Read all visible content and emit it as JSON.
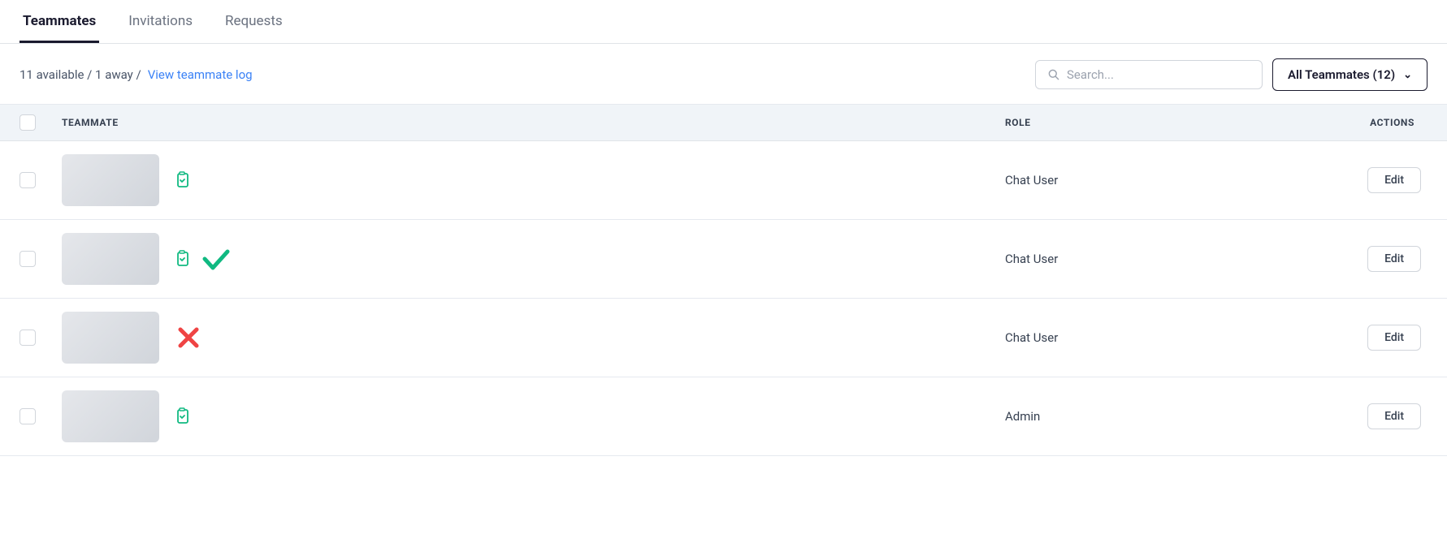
{
  "tabs": [
    {
      "id": "teammates",
      "label": "Teammates",
      "active": true
    },
    {
      "id": "invitations",
      "label": "Invitations",
      "active": false
    },
    {
      "id": "requests",
      "label": "Requests",
      "active": false
    }
  ],
  "toolbar": {
    "stats": "11 available / 1 away /",
    "view_log_label": "View teammate log",
    "search_placeholder": "Search...",
    "filter_label": "All Teammates (12)"
  },
  "table": {
    "columns": {
      "teammate": "TEAMMATE",
      "role": "ROLE",
      "actions": "ACTIONS"
    },
    "rows": [
      {
        "id": 1,
        "has_clipboard": true,
        "has_check": false,
        "has_cross": false,
        "role": "Chat User",
        "edit_label": "Edit"
      },
      {
        "id": 2,
        "has_clipboard": true,
        "has_check": true,
        "has_cross": false,
        "role": "Chat User",
        "edit_label": "Edit"
      },
      {
        "id": 3,
        "has_clipboard": false,
        "has_check": false,
        "has_cross": true,
        "role": "Chat User",
        "edit_label": "Edit"
      },
      {
        "id": 4,
        "has_clipboard": true,
        "has_check": false,
        "has_cross": false,
        "role": "Admin",
        "edit_label": "Edit"
      }
    ]
  }
}
